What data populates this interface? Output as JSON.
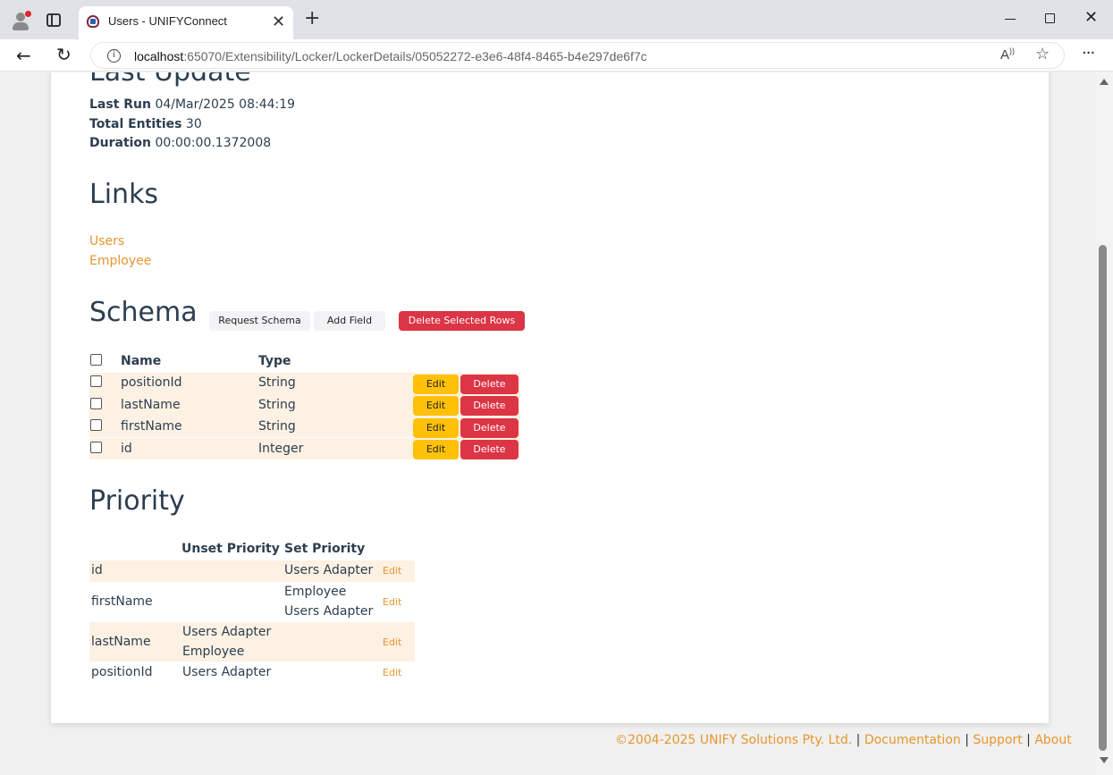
{
  "browser": {
    "tab_title": "Users - UNIFYConnect",
    "tab_close": "✕",
    "new_tab": "+",
    "url_host": "localhost",
    "url_path": ":65070/Extensibility/Locker/LockerDetails/05052272-e3e6-48f4-8465-b4e297de6f7c"
  },
  "last_update": {
    "heading": "Last Update",
    "last_run_label": "Last Run",
    "last_run_value": "04/Mar/2025 08:44:19",
    "total_entities_label": "Total Entities",
    "total_entities_value": "30",
    "duration_label": "Duration",
    "duration_value": "00:00:00.1372008"
  },
  "links": {
    "heading": "Links",
    "items": [
      "Users",
      "Employee"
    ]
  },
  "schema": {
    "heading": "Schema",
    "request_schema_label": "Request Schema",
    "add_field_label": "Add Field",
    "delete_selected_label": "Delete Selected Rows",
    "columns": [
      "Name",
      "Type"
    ],
    "edit_label": "Edit",
    "delete_label": "Delete",
    "rows": [
      {
        "name": "positionId",
        "type": "String"
      },
      {
        "name": "lastName",
        "type": "String"
      },
      {
        "name": "firstName",
        "type": "String"
      },
      {
        "name": "id",
        "type": "Integer"
      }
    ]
  },
  "priority": {
    "heading": "Priority",
    "columns": [
      "Unset Priority",
      "Set Priority"
    ],
    "edit_label": "Edit",
    "rows": [
      {
        "name": "id",
        "unset": [],
        "set": [
          "Users Adapter"
        ]
      },
      {
        "name": "firstName",
        "unset": [],
        "set": [
          "Employee",
          "Users Adapter"
        ]
      },
      {
        "name": "lastName",
        "unset": [
          "Users Adapter",
          "Employee"
        ],
        "set": []
      },
      {
        "name": "positionId",
        "unset": [
          "Users Adapter"
        ],
        "set": []
      }
    ]
  },
  "footer": {
    "copyright": "©2004-2025 UNIFY Solutions Pty. Ltd.",
    "sep": "|",
    "documentation": "Documentation",
    "support": "Support",
    "about": "About"
  },
  "colors": {
    "accent": "#e8962e",
    "danger": "#dc3545",
    "warning": "#ffc107",
    "row_tint": "#fdf1e3"
  }
}
